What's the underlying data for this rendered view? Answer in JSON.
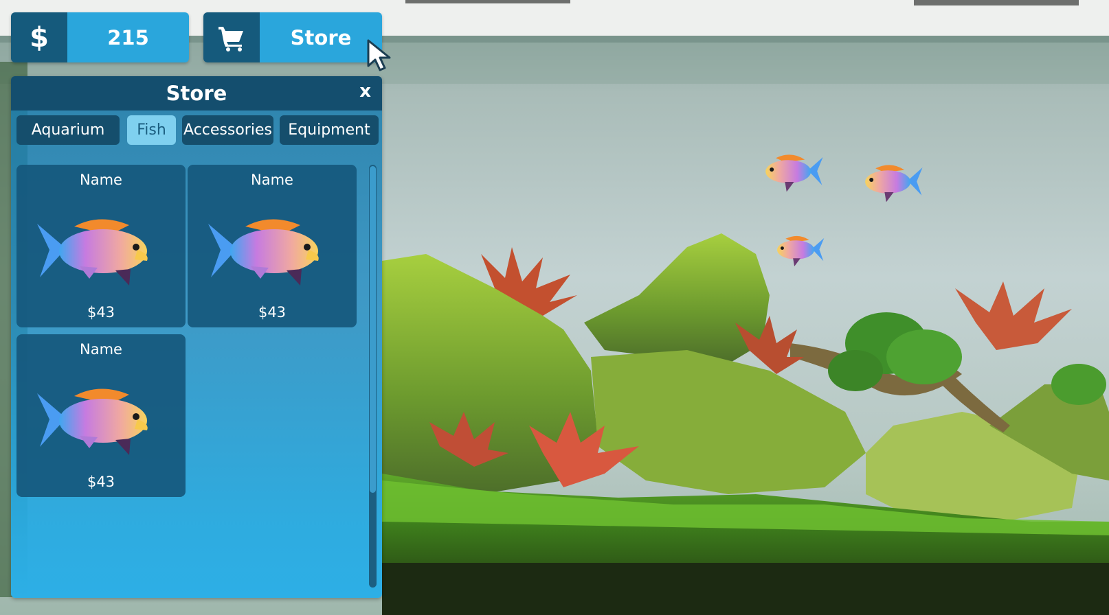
{
  "hud": {
    "money": {
      "icon": "dollar-icon",
      "symbol": "$",
      "value": "215"
    },
    "store": {
      "icon": "cart-icon",
      "label": "Store"
    }
  },
  "store_panel": {
    "title": "Store",
    "close_label": "x",
    "tabs": [
      {
        "label": "Aquarium",
        "active": false
      },
      {
        "label": "Fish",
        "active": true
      },
      {
        "label": "Accessories",
        "active": false
      },
      {
        "label": "Equipment",
        "active": false
      }
    ],
    "items": [
      {
        "name": "Name",
        "price": "$43",
        "icon": "fish-icon"
      },
      {
        "name": "Name",
        "price": "$43",
        "icon": "fish-icon"
      },
      {
        "name": "Name",
        "price": "$43",
        "icon": "fish-icon"
      }
    ]
  },
  "colors": {
    "hud_dark": "#155a7c",
    "hud_light": "#2aa6dc",
    "panel_header": "#144e6e",
    "tab_bg": "#154e6c",
    "tab_active": "#7fd0ef",
    "card_bg": "#16587d"
  }
}
